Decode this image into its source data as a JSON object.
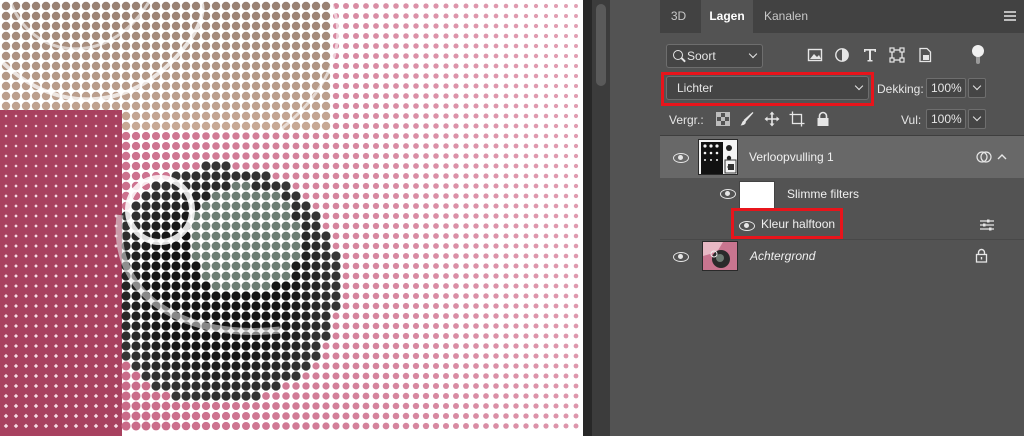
{
  "panel": {
    "tabs": [
      {
        "label": "3D",
        "active": false
      },
      {
        "label": "Lagen",
        "active": true
      },
      {
        "label": "Kanalen",
        "active": false
      }
    ],
    "filter": {
      "label": "Soort",
      "icon": "search-icon"
    },
    "filter_icons": [
      "image-filter-icon",
      "adjustment-filter-icon",
      "type-filter-icon",
      "shape-filter-icon",
      "smart-object-filter-icon"
    ],
    "blend_mode": "Lichter",
    "opacity_label": "Dekking:",
    "opacity_value": "100%",
    "lock_label": "Vergr.:",
    "lock_icons": [
      "lock-transparent-icon",
      "lock-image-icon",
      "lock-position-icon",
      "artboard-lock-icon",
      "lock-all-icon"
    ],
    "fill_label": "Vul:",
    "fill_value": "100%",
    "layers": [
      {
        "name": "Verloopvulling 1",
        "visible": true,
        "selected": true,
        "type": "smart-object"
      },
      {
        "name": "Slimme filters",
        "visible": true,
        "type": "smart-filter-mask"
      },
      {
        "name": "Kleur halftoon",
        "visible": true,
        "type": "filter"
      },
      {
        "name": "Achtergrond",
        "visible": true,
        "italic": true,
        "locked": true
      }
    ]
  },
  "colors": {
    "panel_bg": "#535353",
    "tab_bar_bg": "#424242",
    "selected_row_bg": "#686868",
    "highlight_red": "#e8141b",
    "halftone_pink": "#c96a88",
    "halftone_magenta": "#a8415f"
  }
}
